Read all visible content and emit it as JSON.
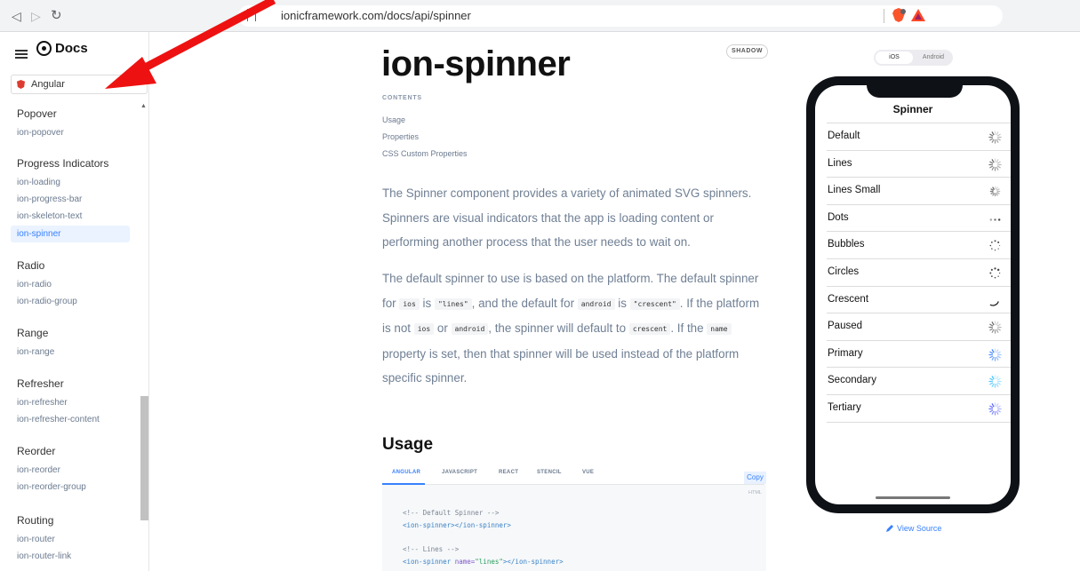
{
  "browser": {
    "back_icon": "back-icon",
    "forward_icon": "forward-icon",
    "reload_icon": "reload-icon",
    "url": "ionicframework.com/docs/api/spinner"
  },
  "sidebar": {
    "logo_text": "Docs",
    "framework": "Angular",
    "groups": [
      {
        "title": "Popover",
        "items": [
          "ion-popover"
        ]
      },
      {
        "title": "Progress Indicators",
        "items": [
          "ion-loading",
          "ion-progress-bar",
          "ion-skeleton-text",
          "ion-spinner"
        ]
      },
      {
        "title": "Radio",
        "items": [
          "ion-radio",
          "ion-radio-group"
        ]
      },
      {
        "title": "Range",
        "items": [
          "ion-range"
        ]
      },
      {
        "title": "Refresher",
        "items": [
          "ion-refresher",
          "ion-refresher-content"
        ]
      },
      {
        "title": "Reorder",
        "items": [
          "ion-reorder",
          "ion-reorder-group"
        ]
      },
      {
        "title": "Routing",
        "items": [
          "ion-router",
          "ion-router-link"
        ]
      }
    ],
    "active_item": "ion-spinner"
  },
  "content": {
    "title": "ion-spinner",
    "shadow_badge": "SHADOW",
    "contents_label": "CONTENTS",
    "toc": [
      "Usage",
      "Properties",
      "CSS Custom Properties"
    ],
    "intro": "The Spinner component provides a variety of animated SVG spinners. Spinners are visual indicators that the app is loading content or performing another process that the user needs to wait on.",
    "para2": {
      "t1": "The default spinner to use is based on the platform. The default spinner for ",
      "c1": "ios",
      "t2": " is ",
      "c2": "\"lines\"",
      "t3": ", and the default for ",
      "c3": "android",
      "t4": " is ",
      "c4": "\"crescent\"",
      "t5": ". If the platform is not ",
      "c5": "ios",
      "t6": " or ",
      "c6": "android",
      "t7": ", the spinner will default to ",
      "c7": "crescent",
      "t8": ". If the ",
      "c8": "name",
      "t9": " property is set, then that spinner will be used instead of the platform specific spinner."
    },
    "usage_title": "Usage",
    "code_tabs": [
      "ANGULAR",
      "JAVASCRIPT",
      "REACT",
      "STENCIL",
      "VUE"
    ],
    "copy_label": "Copy",
    "code_lang": "HTML",
    "code": {
      "l1": "<!-- Default Spinner -->",
      "l2_open": "<ion-spinner>",
      "l2_close": "</ion-spinner>",
      "l3": "<!-- Lines -->",
      "l4_open": "<ion-spinner ",
      "l4_attr": "name=",
      "l4_val": "\"lines\"",
      "l4_close": "></ion-spinner>"
    }
  },
  "demo": {
    "seg_ios": "iOS",
    "seg_android": "Android",
    "header": "Spinner",
    "rows": [
      {
        "label": "Default",
        "spinner": "lines",
        "color": "#666666"
      },
      {
        "label": "Lines",
        "spinner": "lines",
        "color": "#666666"
      },
      {
        "label": "Lines Small",
        "spinner": "lines-small",
        "color": "#666666"
      },
      {
        "label": "Dots",
        "spinner": "dots",
        "color": "#444444"
      },
      {
        "label": "Bubbles",
        "spinner": "bubbles",
        "color": "#444444"
      },
      {
        "label": "Circles",
        "spinner": "circles",
        "color": "#444444"
      },
      {
        "label": "Crescent",
        "spinner": "crescent",
        "color": "#222222"
      },
      {
        "label": "Paused",
        "spinner": "lines",
        "color": "#666666"
      },
      {
        "label": "Primary",
        "spinner": "lines",
        "color": "#3880ff"
      },
      {
        "label": "Secondary",
        "spinner": "lines",
        "color": "#3dc2ff"
      },
      {
        "label": "Tertiary",
        "spinner": "lines",
        "color": "#5260ff"
      }
    ],
    "view_source": "View Source"
  }
}
